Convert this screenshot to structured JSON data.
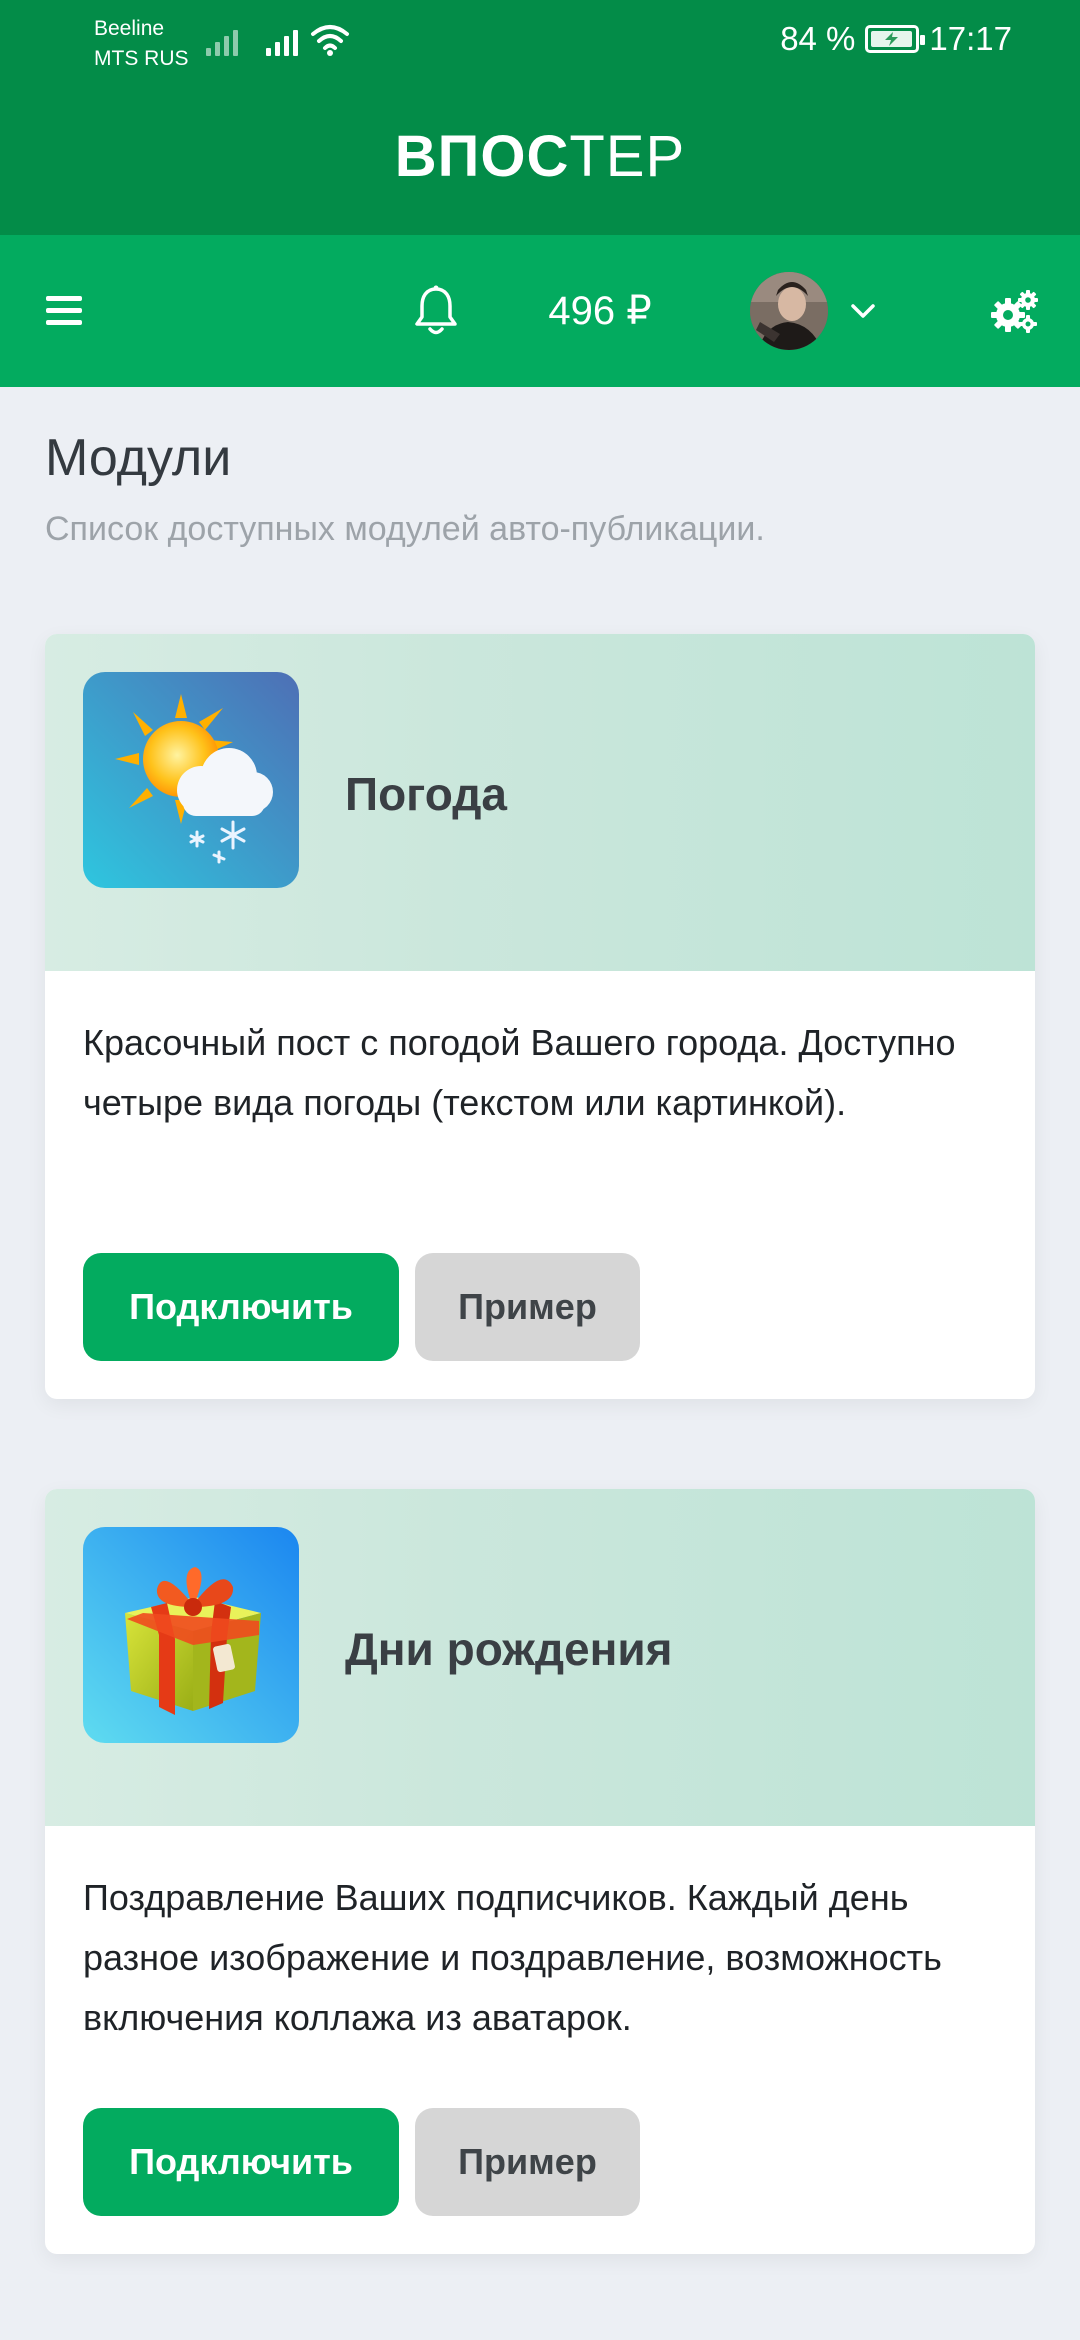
{
  "status_bar": {
    "carrier_1": "Beeline",
    "carrier_2": "MTS RUS",
    "battery": "84 %",
    "time": "17:17"
  },
  "header": {
    "brand_bold": "ВПОС",
    "brand_light": "ТЕР"
  },
  "nav": {
    "balance": "496 ₽",
    "icons": [
      "menu-icon",
      "bell-icon",
      "avatar",
      "chevron-down-icon",
      "gears-icon"
    ]
  },
  "page": {
    "title": "Модули",
    "subtitle": "Список доступных модулей авто-публикации."
  },
  "modules": [
    {
      "title": "Погода",
      "icon": "weather-icon",
      "description": "Красочный пост с погодой Вашего города. Доступно четыре вида погоды (текстом или картинкой).",
      "connect_label": "Подключить",
      "example_label": "Пример"
    },
    {
      "title": "Дни рождения",
      "icon": "gift-icon",
      "description": "Поздравление Ваших подписчиков. Каждый день разное изображение и поздравление, возможность включения коллажа из аватарок.",
      "connect_label": "Подключить",
      "example_label": "Пример"
    }
  ],
  "colors": {
    "header_dark": "#038c48",
    "header_accent": "#03ab5f",
    "button_primary": "#03ab5f",
    "button_secondary": "#d6d6d6",
    "background": "#eceff4"
  }
}
